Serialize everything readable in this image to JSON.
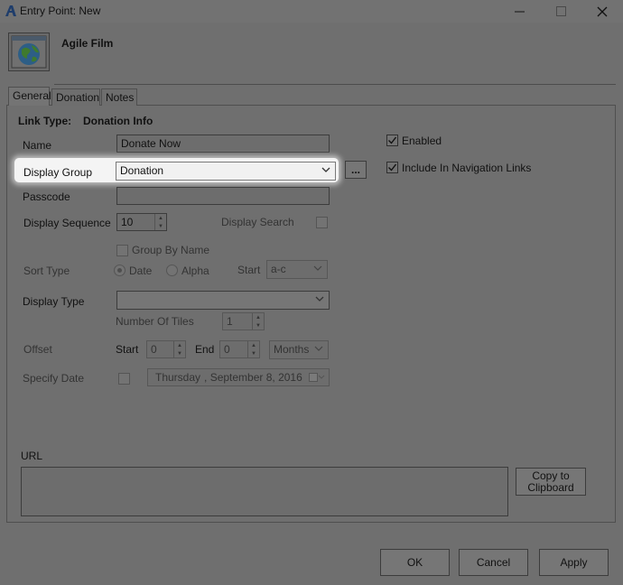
{
  "window": {
    "title": "Entry Point: New",
    "logo_icon": "app-logo-icon",
    "minimize_icon": "minimize-icon",
    "maximize_icon": "maximize-icon",
    "close_icon": "close-icon"
  },
  "header": {
    "icon": "globe-window-icon",
    "title": "Agile Film"
  },
  "tabs": [
    {
      "label": "General",
      "active": true
    },
    {
      "label": "Donation",
      "active": false
    },
    {
      "label": "Notes",
      "active": false
    }
  ],
  "form": {
    "link_type_label": "Link Type:",
    "link_type_value": "Donation Info",
    "name_label": "Name",
    "name_value": "Donate Now",
    "display_group_label": "Display Group",
    "display_group_value": "Donation",
    "ellipsis_label": "...",
    "passcode_label": "Passcode",
    "passcode_value": "",
    "display_sequence_label": "Display Sequence",
    "display_sequence_value": "10",
    "display_search_label": "Display Search",
    "display_search_checked": false,
    "enabled_label": "Enabled",
    "enabled_checked": true,
    "include_nav_label": "Include In Navigation Links",
    "include_nav_checked": true,
    "group_by_name_label": "Group By Name",
    "group_by_name_checked": false,
    "sort_type_label": "Sort Type",
    "sort_date_label": "Date",
    "sort_alpha_label": "Alpha",
    "sort_selected": "Date",
    "start_label": "Start",
    "start_value": "a-c",
    "display_type_label": "Display Type",
    "display_type_value": "",
    "number_of_tiles_label": "Number Of Tiles",
    "number_of_tiles_value": "1",
    "offset_label": "Offset",
    "offset_start_label": "Start",
    "offset_start_value": "0",
    "offset_end_label": "End",
    "offset_end_value": "0",
    "offset_unit_value": "Months",
    "specify_date_label": "Specify Date",
    "specify_date_checked": false,
    "date_day": "Thursday",
    "date_rest": ", September  8, 2016",
    "url_label": "URL",
    "url_value": "",
    "copy_button_label": "Copy to Clipboard"
  },
  "footer": {
    "ok_label": "OK",
    "cancel_label": "Cancel",
    "apply_label": "Apply"
  }
}
